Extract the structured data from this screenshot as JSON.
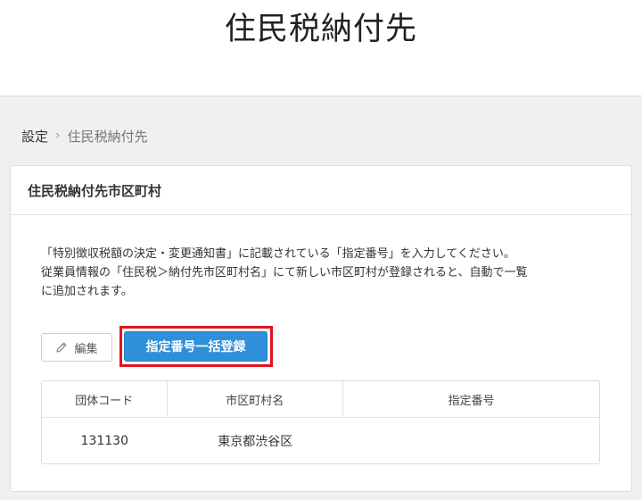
{
  "page": {
    "title": "住民税納付先"
  },
  "breadcrumb": {
    "parent": "設定",
    "separator": "›",
    "current": "住民税納付先"
  },
  "card": {
    "title": "住民税納付先市区町村",
    "description_line1": "「特別徴収税額の決定・変更通知書」に記載されている「指定番号」を入力してください。",
    "description_line2": "従業員情報の「住民税＞納付先市区町村名」にて新しい市区町村が登録されると、自動で一覧",
    "description_line3": "に追加されます。"
  },
  "actions": {
    "edit_label": "編集",
    "bulk_register_label": "指定番号一括登録"
  },
  "table": {
    "headers": [
      "団体コード",
      "市区町村名",
      "指定番号"
    ],
    "rows": [
      {
        "code": "131130",
        "municipality": "東京都渋谷区",
        "designated_number": ""
      }
    ]
  },
  "colors": {
    "primary_button": "#2f8fd9",
    "highlight": "#e0141e"
  },
  "icons": {
    "edit": "pencil-icon"
  }
}
